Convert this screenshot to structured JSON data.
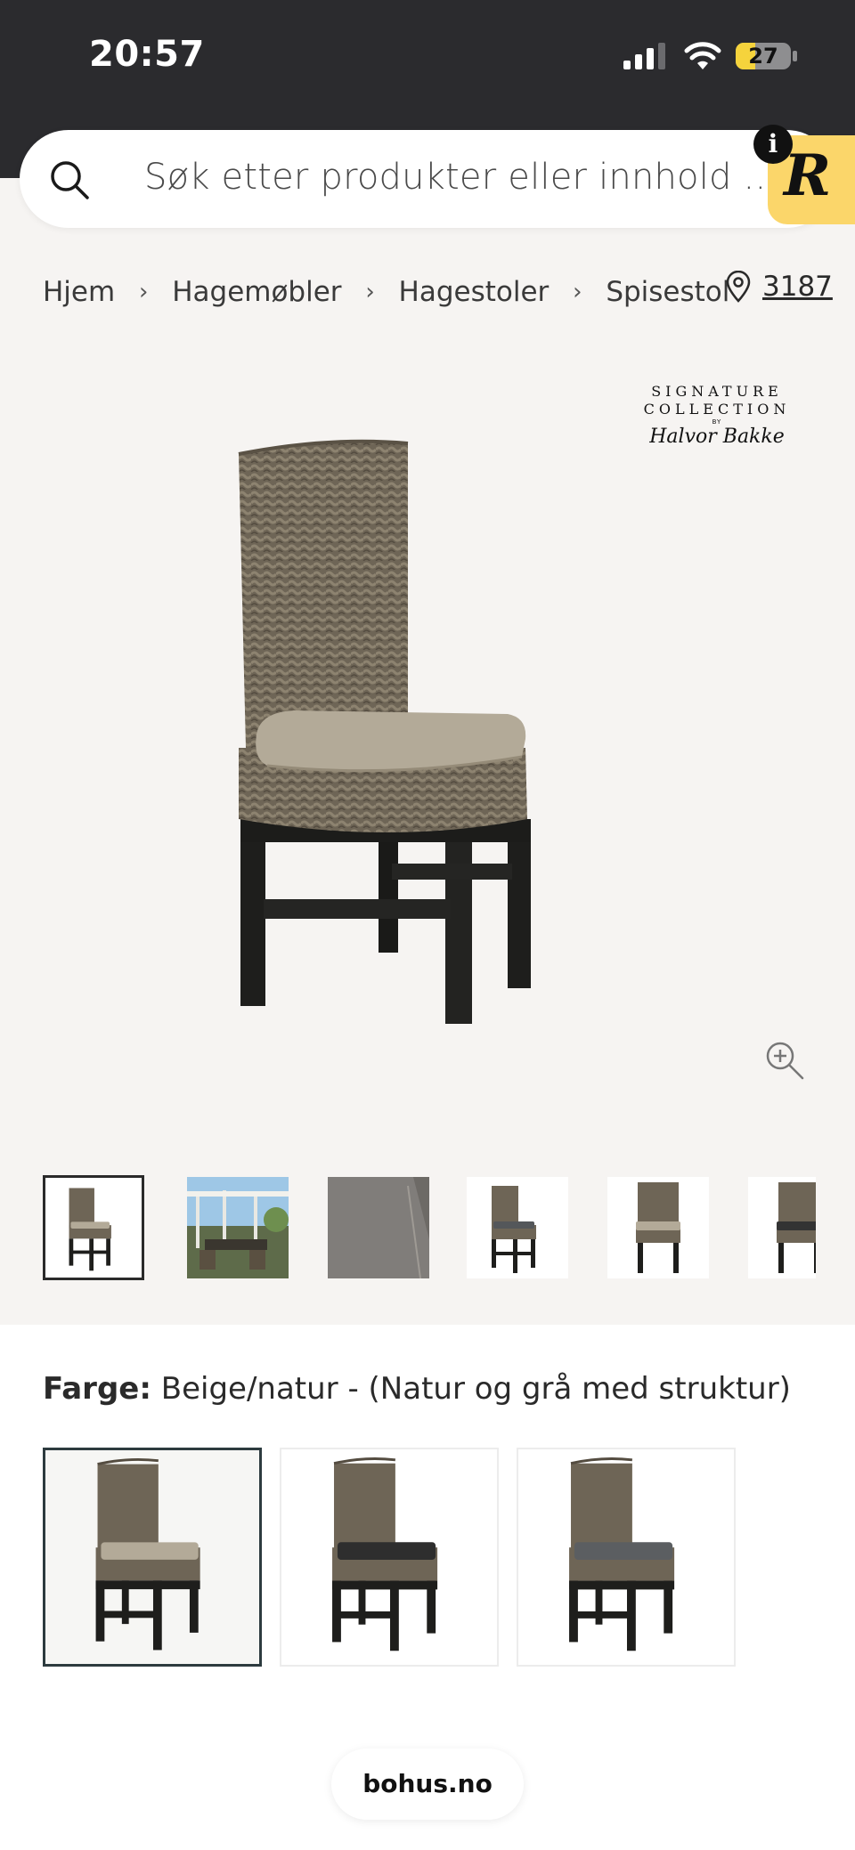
{
  "status_bar": {
    "time": "20:57",
    "battery_level": "27"
  },
  "search": {
    "placeholder": "Søk etter produkter eller innhold ..."
  },
  "overlay_badge": {
    "letter": "R",
    "info": "i"
  },
  "breadcrumb": {
    "items": [
      "Hjem",
      "Hagemøbler",
      "Hagestoler",
      "Spisestol"
    ],
    "separator": "›"
  },
  "store": {
    "number": "3187"
  },
  "brand": {
    "line1": "SIGNATURE",
    "line2": "COLLECTION",
    "by": "BY",
    "signature": "Halvor Bakke"
  },
  "gallery": {
    "selected_index": 0,
    "thumbnails": [
      "chair-beige",
      "garden-scene",
      "fabric-texture",
      "chair-grey",
      "chair-beige-front",
      "chair-black"
    ]
  },
  "color_selector": {
    "label": "Farge:",
    "value": "Beige/natur - (Natur og grå med struktur)",
    "options": [
      "beige-cushion",
      "black-cushion",
      "grey-cushion"
    ],
    "selected_index": 0
  },
  "footer": {
    "site": "bohus.no"
  },
  "colors": {
    "status_bar_bg": "#2b2b2e",
    "page_bg": "#f6f4f2",
    "badge_yellow": "#fbd66a",
    "battery_yellow": "#f5d33c"
  }
}
